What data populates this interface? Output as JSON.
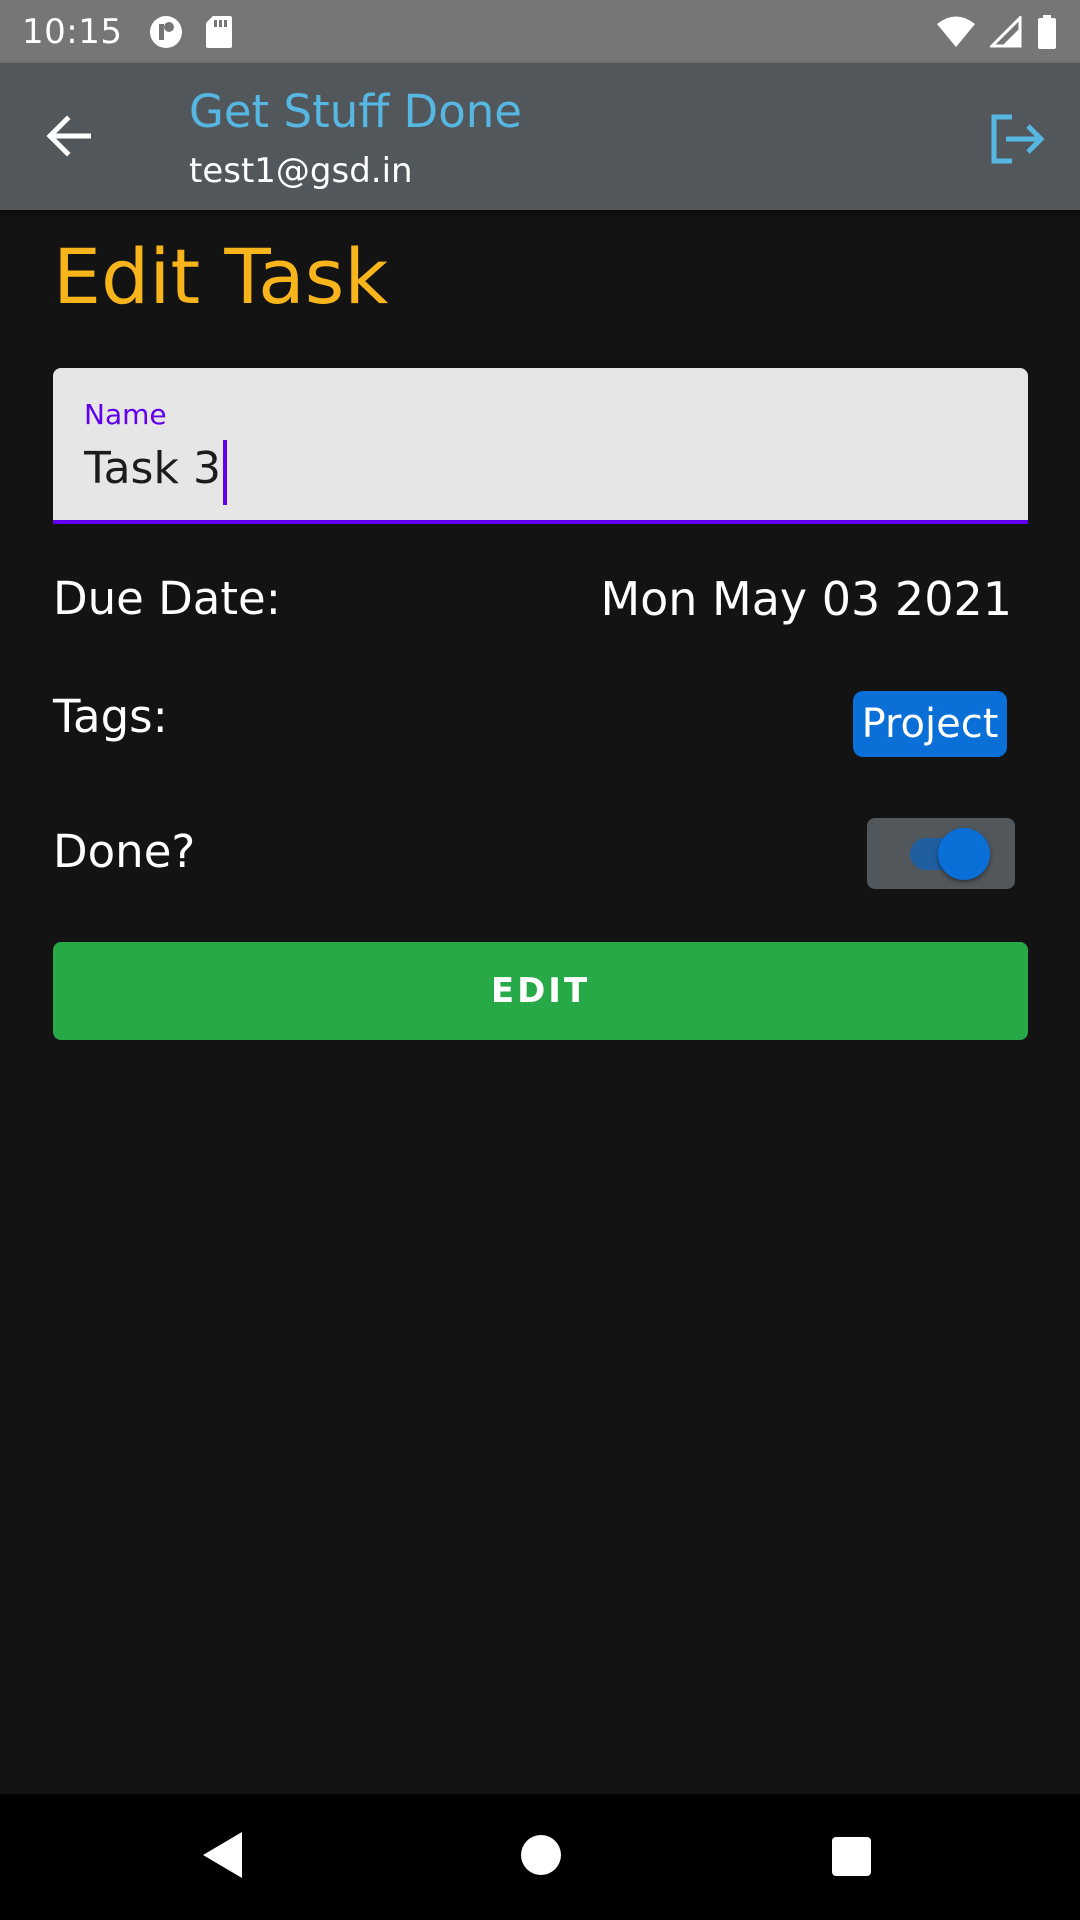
{
  "status_bar": {
    "time": "10:15",
    "icons": [
      "notification-app-icon",
      "sd-card-icon",
      "wifi-icon",
      "cell-signal-icon",
      "battery-icon"
    ]
  },
  "app_bar": {
    "title": "Get Stuff Done",
    "subtitle": "test1@gsd.in",
    "back_icon": "arrow-left-icon",
    "logout_icon": "logout-icon"
  },
  "page": {
    "title": "Edit Task"
  },
  "form": {
    "name_label": "Name",
    "name_value": "Task 3",
    "due_date_label": "Due Date:",
    "due_date_value": "Mon May 03 2021",
    "tags_label": "Tags:",
    "tags": [
      "Project"
    ],
    "done_label": "Done?",
    "done": true,
    "submit_label": "EDIT"
  },
  "colors": {
    "accent_title": "#f7b51b",
    "app_title": "#56b7e3",
    "field_focus": "#6200ee",
    "tag_chip": "#0a6fd6",
    "submit_button": "#27a947"
  },
  "nav_bar": {
    "icons": [
      "nav-back-icon",
      "nav-home-icon",
      "nav-recents-icon"
    ]
  }
}
